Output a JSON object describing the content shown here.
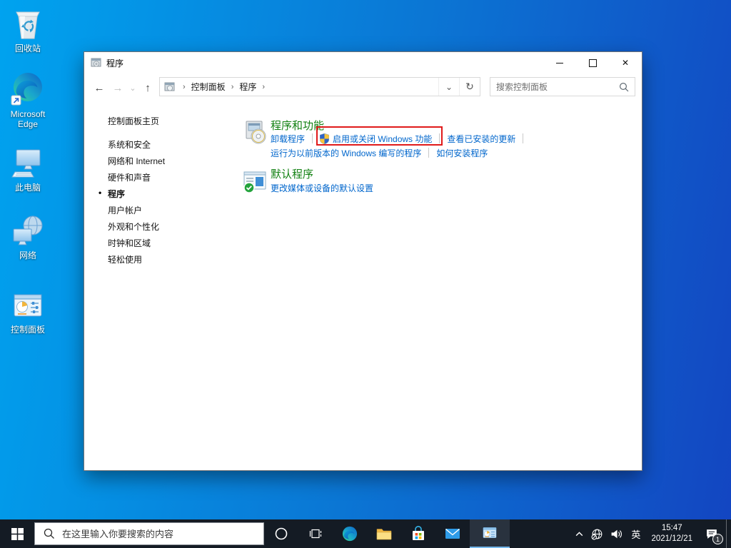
{
  "desktop": {
    "icons": [
      {
        "label": "回收站"
      },
      {
        "label": "Microsoft Edge"
      },
      {
        "label": "此电脑"
      },
      {
        "label": "网络"
      },
      {
        "label": "控制面板"
      }
    ]
  },
  "window": {
    "title": "程序",
    "controls": {
      "close": "✕"
    },
    "toolbar": {
      "back": "←",
      "forward": "→",
      "dropdown": "⌄",
      "up": "↑",
      "refresh": "↻",
      "address_dropdown": "⌄"
    },
    "breadcrumb": {
      "separator": "›",
      "items": [
        "控制面板",
        "程序"
      ]
    },
    "search": {
      "placeholder": "搜索控制面板"
    },
    "sidebar": {
      "bullet": "•",
      "home": "控制面板主页",
      "items": [
        "系统和安全",
        "网络和 Internet",
        "硬件和声音",
        "程序",
        "用户帐户",
        "外观和个性化",
        "时钟和区域",
        "轻松使用"
      ]
    },
    "sections": {
      "programs_features": {
        "title": "程序和功能",
        "link_uninstall": "卸载程序",
        "link_windows_features": "启用或关闭 Windows 功能",
        "link_installed_updates": "查看已安装的更新",
        "link_run_older": "运行为以前版本的 Windows 编写的程序",
        "link_how_install": "如何安装程序"
      },
      "default_programs": {
        "title": "默认程序",
        "link_change_media": "更改媒体或设备的默认设置"
      }
    },
    "highlight_color": "#e01a1a"
  },
  "taskbar": {
    "search_placeholder": "在这里输入你要搜索的内容",
    "ime": "英",
    "clock": {
      "time": "15:47",
      "date": "2021/12/21"
    },
    "notification_badge": "1"
  },
  "colors": {
    "heading_green": "#128112",
    "link_blue": "#0066cc",
    "taskbar_bg": "#141b24",
    "active_underline": "#76b9ed",
    "desktop_left": "#00a3ef",
    "desktop_right": "#1345c1"
  }
}
